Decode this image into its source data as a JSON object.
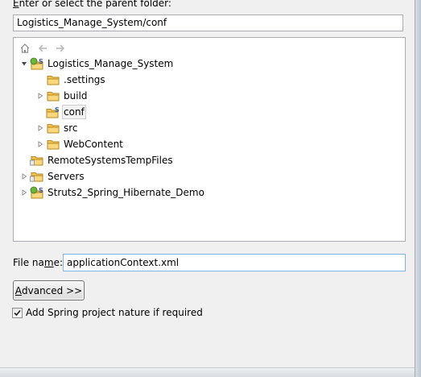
{
  "header": {
    "label": "Enter or select the parent folder:",
    "mnemonic": "E",
    "label_rest": "nter or select the parent folder:"
  },
  "parent_folder": {
    "value": "Logistics_Manage_System/conf"
  },
  "tree_toolbar": {
    "buttons": [
      {
        "icon": "home-icon"
      },
      {
        "icon": "back-arrow-icon"
      },
      {
        "icon": "forward-arrow-icon"
      }
    ]
  },
  "tree": {
    "items": [
      {
        "label": "Logistics_Manage_System",
        "twisty": "expanded",
        "icon": "spring-project-icon",
        "depth": 0
      },
      {
        "label": ".settings",
        "twisty": "none",
        "icon": "folder-icon",
        "depth": 1
      },
      {
        "label": "build",
        "twisty": "collapsed",
        "icon": "folder-icon",
        "depth": 1
      },
      {
        "label": "conf",
        "twisty": "none",
        "icon": "spring-folder-icon",
        "depth": 1,
        "selected": true
      },
      {
        "label": "src",
        "twisty": "collapsed",
        "icon": "folder-icon",
        "depth": 1
      },
      {
        "label": "WebContent",
        "twisty": "collapsed",
        "icon": "folder-icon",
        "depth": 1
      },
      {
        "label": "RemoteSystemsTempFiles",
        "twisty": "none",
        "icon": "project-folder-icon",
        "depth": 0
      },
      {
        "label": "Servers",
        "twisty": "collapsed",
        "icon": "project-folder-icon",
        "depth": 0
      },
      {
        "label": "Struts2_Spring_Hibernate_Demo",
        "twisty": "collapsed",
        "icon": "spring-project-icon",
        "depth": 0
      }
    ]
  },
  "file_name": {
    "label": "File name:",
    "label_before": "File na",
    "mnemonic": "m",
    "label_after": "e:",
    "value": "applicationContext.xml"
  },
  "advanced_button": {
    "label": "Advanced >>",
    "mnemonic": "A",
    "label_rest": "dvanced >>"
  },
  "spring_nature": {
    "label": "Add Spring project nature if required",
    "checked": true
  },
  "colors": {
    "background": "#f0f0f0",
    "folder": "#f2c45a",
    "spring_green": "#6db33f"
  }
}
